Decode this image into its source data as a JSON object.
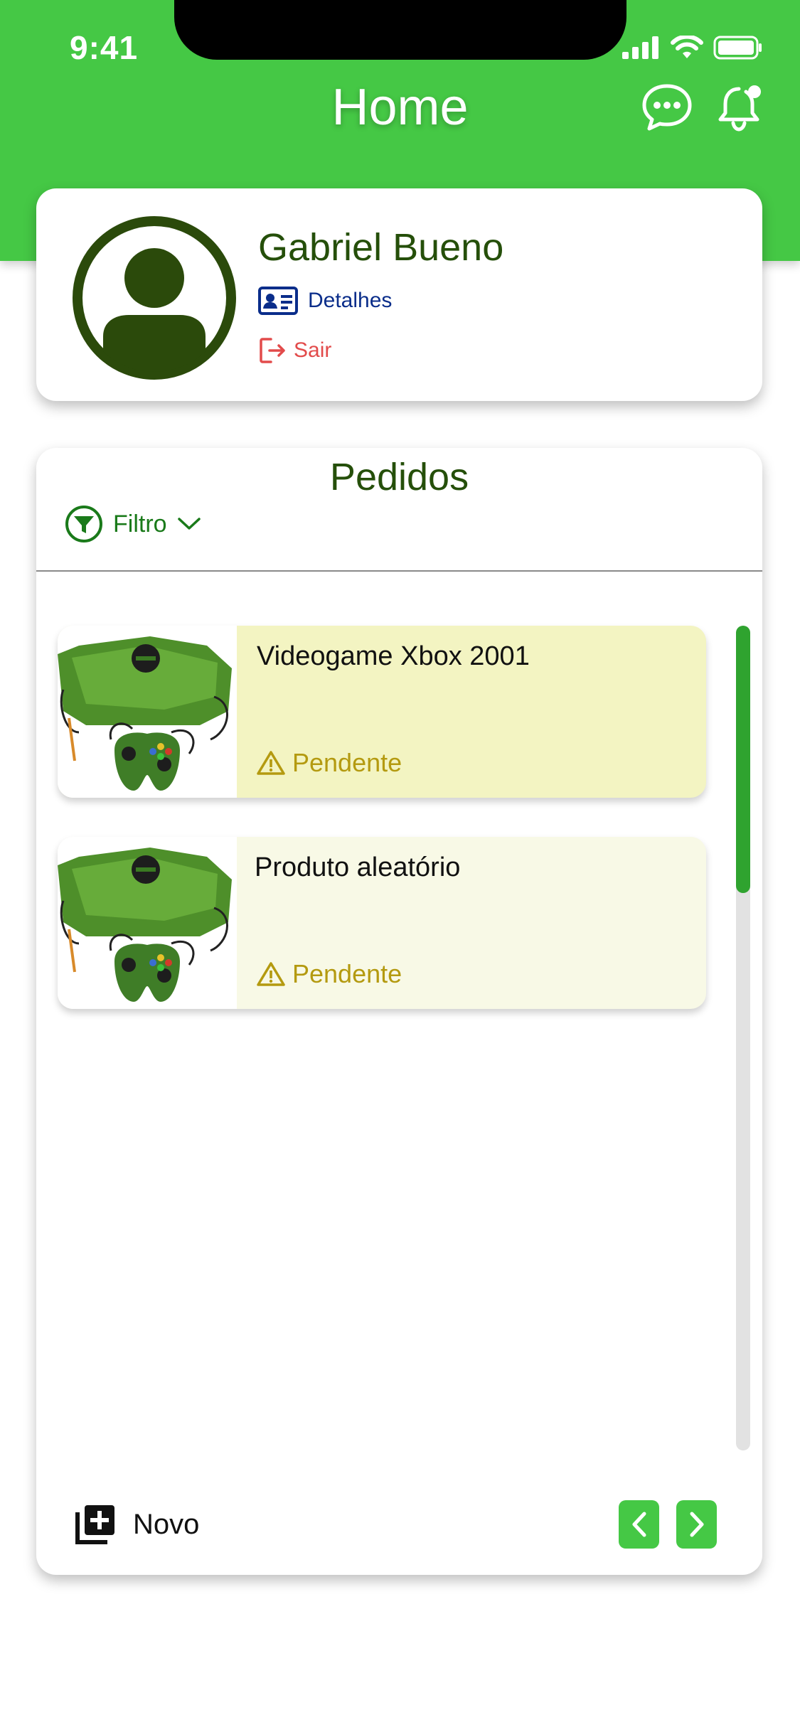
{
  "status_bar": {
    "time": "9:41"
  },
  "header": {
    "title": "Home"
  },
  "profile": {
    "name": "Gabriel Bueno",
    "details_label": "Detalhes",
    "logout_label": "Sair"
  },
  "orders": {
    "title": "Pedidos",
    "filter_label": "Filtro",
    "items": [
      {
        "name": "Videogame Xbox 2001",
        "status": "Pendente"
      },
      {
        "name": "Produto aleatório",
        "status": "Pendente"
      }
    ],
    "new_label": "Novo"
  },
  "colors": {
    "brand_green": "#45c845",
    "dark_green": "#254f0a",
    "pending": "#b49a10",
    "logout_red": "#e24b4b",
    "details_blue": "#0a2d8a"
  },
  "icons": [
    "chat-icon",
    "bell-icon",
    "avatar-icon",
    "id-card-icon",
    "logout-icon",
    "filter-icon",
    "chevron-down-icon",
    "warning-icon",
    "add-library-icon",
    "chevron-left-icon",
    "chevron-right-icon"
  ]
}
